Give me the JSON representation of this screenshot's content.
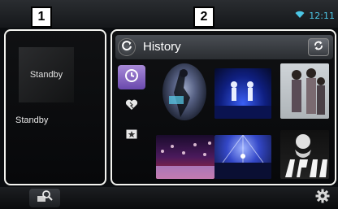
{
  "status_bar": {
    "time": "12:11",
    "wifi_icon": "wifi-icon"
  },
  "callouts": {
    "one": "1",
    "two": "2"
  },
  "now_playing": {
    "artwork_label": "Standby",
    "title": "Standby"
  },
  "history_panel": {
    "title": "History",
    "tabs": [
      {
        "name": "history",
        "icon": "clock-icon",
        "active": true
      },
      {
        "name": "favorites",
        "icon": "heart-icon",
        "active": false
      },
      {
        "name": "starred",
        "icon": "star-icon",
        "active": false
      }
    ]
  },
  "colors": {
    "accent_tab": "#8a6cc8",
    "frame": "#f4f4f0",
    "time": "#4cc7e6"
  }
}
